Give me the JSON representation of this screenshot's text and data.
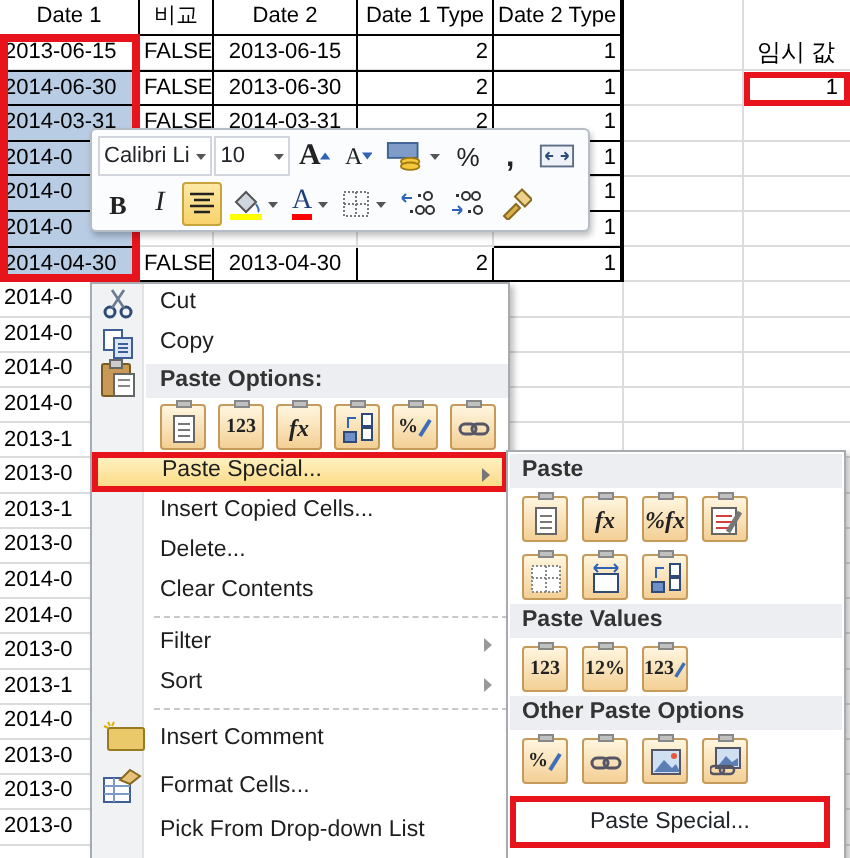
{
  "sheet": {
    "columns": [
      "Date 1",
      "비교",
      "Date 2",
      "Date 1 Type",
      "Date 2 Type"
    ],
    "date_column_outlined": true,
    "rows": [
      {
        "selected": false,
        "date_1": "2013-06-15",
        "compare": "FALSE",
        "date_2": "2013-06-15",
        "date_1_type": "2",
        "date_2_type": "1"
      },
      {
        "selected": true,
        "date_1": "2014-06-30",
        "compare": "FALSE",
        "date_2": "2013-06-30",
        "date_1_type": "2",
        "date_2_type": "1"
      },
      {
        "selected": true,
        "date_1": "2014-03-31",
        "compare": "FALSE",
        "date_2": "2014-03-31",
        "date_1_type": "2",
        "date_2_type": "1"
      },
      {
        "selected": true,
        "date_1": "2014-0",
        "date_2_type": "1"
      },
      {
        "selected": true,
        "date_1": "2014-0",
        "date_2_type": "1"
      },
      {
        "selected": true,
        "date_1": "2014-0",
        "date_2_type": "1"
      },
      {
        "selected": true,
        "date_1": "2014-04-30",
        "compare": "FALSE",
        "date_2": "2013-04-30",
        "date_1_type": "2",
        "date_2_type": "1"
      },
      {
        "selected": false,
        "date_1": "2014-0"
      },
      {
        "selected": false,
        "date_1": "2014-0"
      },
      {
        "selected": false,
        "date_1": "2014-0"
      },
      {
        "selected": false,
        "date_1": "2014-0"
      },
      {
        "selected": false,
        "date_1": "2013-1"
      },
      {
        "selected": false,
        "date_1": "2013-0"
      },
      {
        "selected": false,
        "date_1": "2013-1"
      },
      {
        "selected": false,
        "date_1": "2013-0"
      },
      {
        "selected": false,
        "date_1": "2014-0"
      },
      {
        "selected": false,
        "date_1": "2014-0"
      },
      {
        "selected": false,
        "date_1": "2013-0"
      },
      {
        "selected": false,
        "date_1": "2013-1"
      },
      {
        "selected": false,
        "date_1": "2014-0"
      },
      {
        "selected": false,
        "date_1": "2013-0"
      },
      {
        "selected": false,
        "date_1": "2013-0"
      },
      {
        "selected": false,
        "date_1": "2013-0"
      }
    ]
  },
  "temp": {
    "label": "임시 값",
    "value": "1",
    "outlined": true
  },
  "mini_toolbar": {
    "top_row": [
      {
        "kind": "font",
        "value": "Calibri Li"
      },
      {
        "kind": "size",
        "value": "10"
      },
      {
        "kind": "grow",
        "label": "A",
        "selected": false
      },
      {
        "kind": "shrink",
        "label": "A",
        "selected": false
      },
      {
        "kind": "accounting",
        "selected": false,
        "dropdown": true
      },
      {
        "kind": "percent",
        "label": "%",
        "selected": false
      },
      {
        "kind": "comma",
        "label": ",",
        "selected": false
      },
      {
        "kind": "merge",
        "selected": false
      }
    ],
    "bottom_row": [
      {
        "kind": "bold",
        "label": "B",
        "selected": false
      },
      {
        "kind": "italic",
        "label": "I",
        "selected": false
      },
      {
        "kind": "center",
        "selected": true
      },
      {
        "kind": "fill",
        "selected": false,
        "dropdown": true
      },
      {
        "kind": "fontcolor",
        "label": "A",
        "selected": false,
        "dropdown": true
      },
      {
        "kind": "borders",
        "selected": false,
        "dropdown": true
      },
      {
        "kind": "incdec",
        "selected": false
      },
      {
        "kind": "decdec",
        "selected": false
      },
      {
        "kind": "painter",
        "selected": false
      }
    ]
  },
  "context_menu": {
    "items": [
      {
        "kind": "cut",
        "label": "Cut",
        "selected": false
      },
      {
        "kind": "copy",
        "label": "Copy",
        "selected": false
      },
      {
        "kind": "header",
        "label": "Paste Options:"
      },
      {
        "kind": "options",
        "icons": [
          {
            "kind": "page"
          },
          {
            "kind": "values",
            "label": "123"
          },
          {
            "kind": "formula",
            "label": "fx"
          },
          {
            "kind": "transpose"
          },
          {
            "kind": "formatting",
            "label": "%"
          },
          {
            "kind": "link"
          }
        ]
      },
      {
        "kind": "submenu",
        "label": "Paste Special...",
        "selected": true,
        "outlined": true
      },
      {
        "kind": "command",
        "label": "Insert Copied Cells...",
        "selected": false
      },
      {
        "kind": "command",
        "label": "Delete...",
        "selected": false
      },
      {
        "kind": "command",
        "label": "Clear Contents",
        "selected": false
      },
      {
        "kind": "separator"
      },
      {
        "kind": "submenu",
        "label": "Filter",
        "selected": false
      },
      {
        "kind": "submenu",
        "label": "Sort",
        "selected": false
      },
      {
        "kind": "separator"
      },
      {
        "kind": "comment",
        "label": "Insert Comment",
        "selected": false
      },
      {
        "kind": "format",
        "label": "Format Cells...",
        "selected": false
      },
      {
        "kind": "command",
        "label": "Pick From Drop-down List",
        "selected": false
      }
    ]
  },
  "paste_submenu": {
    "sections": [
      {
        "header": "Paste",
        "rows": [
          [
            {
              "kind": "page"
            },
            {
              "kind": "formula",
              "label": "fx"
            },
            {
              "kind": "formula",
              "label": "%fx"
            },
            {
              "kind": "brushpage"
            }
          ],
          [
            {
              "kind": "grid"
            },
            {
              "kind": "widths"
            },
            {
              "kind": "transpose"
            }
          ]
        ]
      },
      {
        "header": "Paste Values",
        "rows": [
          [
            {
              "kind": "values",
              "label": "123"
            },
            {
              "kind": "values",
              "label": "12%"
            },
            {
              "kind": "formatting",
              "label": "123"
            }
          ]
        ]
      },
      {
        "header": "Other Paste Options",
        "rows": [
          [
            {
              "kind": "formatting",
              "label": "%"
            },
            {
              "kind": "link"
            },
            {
              "kind": "picture"
            },
            {
              "kind": "linkpicture"
            }
          ]
        ]
      }
    ],
    "command": {
      "label": "Paste Special...",
      "outlined": true
    }
  }
}
